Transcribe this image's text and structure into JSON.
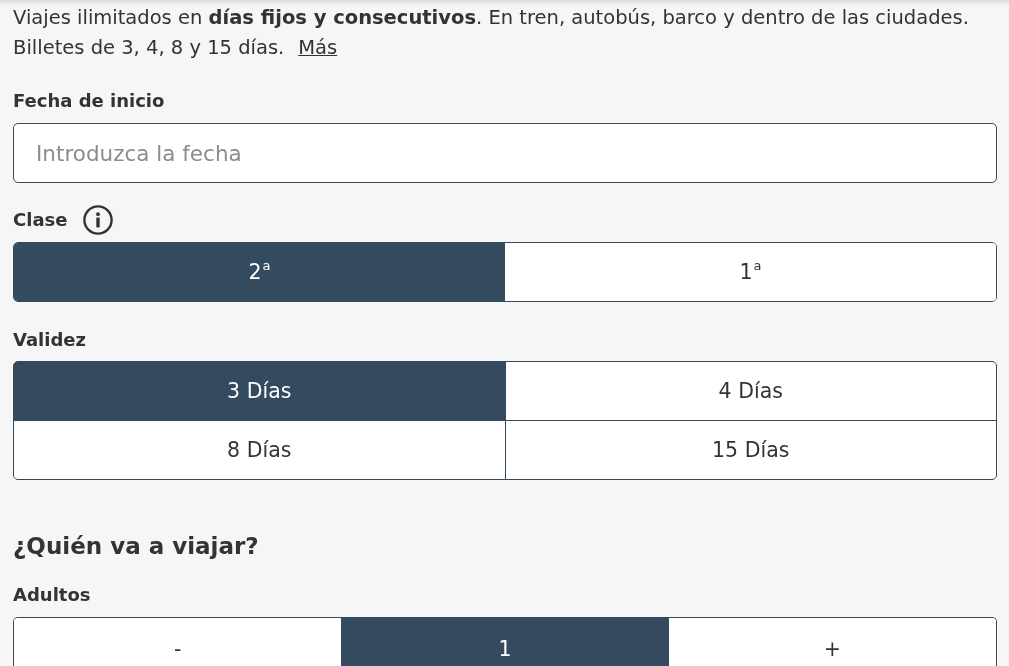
{
  "intro": {
    "sentences": [
      "Viajes ilimitados en **días fijos y consecutivos**. En tren, autobús, barco y dentro de las ciudades.",
      "Billetes de 3, 4, 8 y 15 días."
    ],
    "more_link": "Más"
  },
  "start_date": {
    "label": "Fecha de inicio",
    "placeholder": "Introduzca la fecha"
  },
  "class": {
    "label": "Clase",
    "options": [
      {
        "label": "2$^{a}$",
        "selected": true
      },
      {
        "label": "1$^{a}$",
        "selected": false
      }
    ]
  },
  "validity": {
    "label": "Validez",
    "options": [
      {
        "label": "3 Días",
        "selected": true
      },
      {
        "label": "4 Días",
        "selected": false
      },
      {
        "label": "8 Días",
        "selected": false
      },
      {
        "label": "15 Días",
        "selected": false
      }
    ]
  },
  "travelers": {
    "heading": "¿Quién va a viajar?",
    "adults": {
      "label": "Adultos",
      "decrement": "-",
      "count": "1",
      "increment": "+"
    }
  }
}
